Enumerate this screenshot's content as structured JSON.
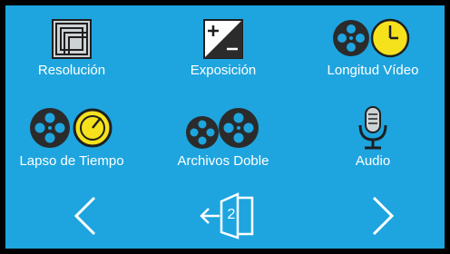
{
  "menu": {
    "items": [
      {
        "label": "Resolución",
        "icon": "resolution-icon"
      },
      {
        "label": "Exposición",
        "icon": "exposure-icon"
      },
      {
        "label": "Longitud Vídeo",
        "icon": "video-length-icon"
      },
      {
        "label": "Lapso de Tiempo",
        "icon": "timelapse-icon"
      },
      {
        "label": "Archivos Doble",
        "icon": "dual-files-icon"
      },
      {
        "label": "Audio",
        "icon": "microphone-icon"
      }
    ]
  },
  "footer": {
    "prev_icon": "chevron-left-icon",
    "exit_icon": "exit-door-icon",
    "exit_page_number": "2",
    "next_icon": "chevron-right-icon"
  },
  "colors": {
    "background": "#1ea5df",
    "icon_dark": "#2b2b2b",
    "accent_yellow": "#f6e21c",
    "text": "#ffffff"
  }
}
